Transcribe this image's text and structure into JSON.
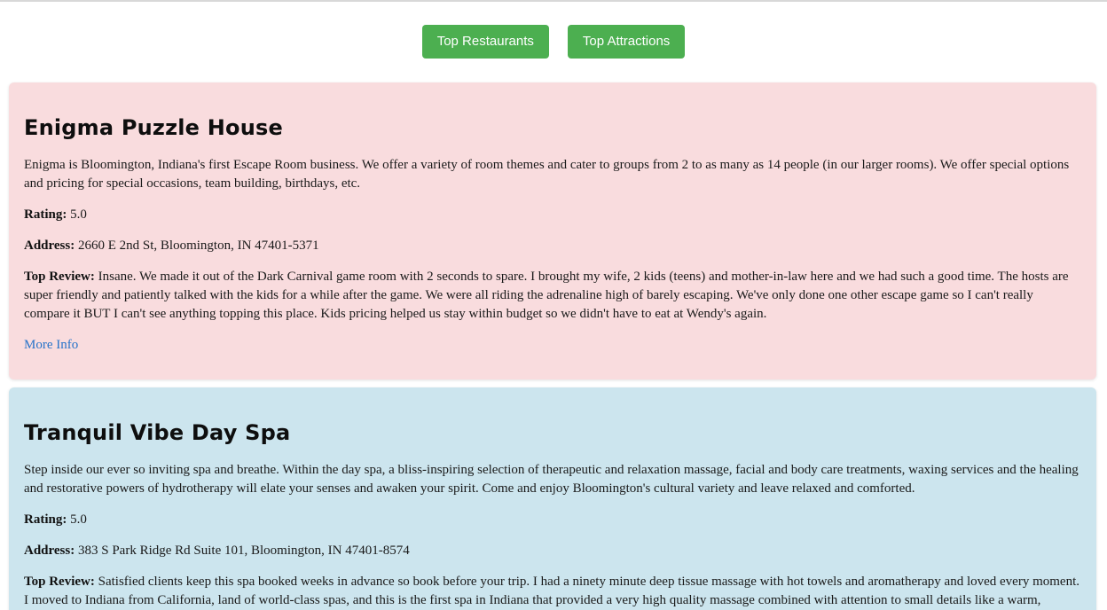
{
  "nav": {
    "restaurants_label": "Top Restaurants",
    "attractions_label": "Top Attractions"
  },
  "colors": {
    "button_green": "#4caf50",
    "card_pink": "#f9dcde",
    "card_blue": "#cce5ee",
    "link_blue": "#2673c9"
  },
  "labels": {
    "rating": "Rating:",
    "address": "Address:",
    "top_review": "Top Review:"
  },
  "attractions": [
    {
      "name": "Enigma Puzzle House",
      "description": "Enigma is Bloomington, Indiana's first Escape Room business. We offer a variety of room themes and cater to groups from 2 to as many as 14 people (in our larger rooms). We offer special options and pricing for special occasions, team building, birthdays, etc.",
      "rating": "5.0",
      "address": "2660 E 2nd St, Bloomington, IN 47401-5371",
      "review": "Insane. We made it out of the Dark Carnival game room with 2 seconds to spare. I brought my wife, 2 kids (teens) and mother-in-law here and we had such a good time. The hosts are super friendly and patiently talked with the kids for a while after the game. We were all riding the adrenaline high of barely escaping. We've only done one other escape game so I can't really compare it BUT I can't see anything topping this place. Kids pricing helped us stay within budget so we didn't have to eat at Wendy's again.",
      "more_info": "More Info"
    },
    {
      "name": "Tranquil Vibe Day Spa",
      "description": "Step inside our ever so inviting spa and breathe. Within the day spa, a bliss-inspiring selection of therapeutic and relaxation massage, facial and body care treatments, waxing services and the healing and restorative powers of hydrotherapy will elate your senses and awaken your spirit. Come and enjoy Bloomington's cultural variety and leave relaxed and comforted.",
      "rating": "5.0",
      "address": "383 S Park Ridge Rd Suite 101, Bloomington, IN 47401-8574",
      "review": "Satisfied clients keep this spa booked weeks in advance so book before your trip. I had a ninety minute deep tissue massage with hot towels and aromatherapy and loved every moment. I moved to Indiana from California, land of world-class spas, and this is the first spa in Indiana that provided a very high quality massage combined with attention to small details like a warm, comfortable massage table,"
    }
  ]
}
